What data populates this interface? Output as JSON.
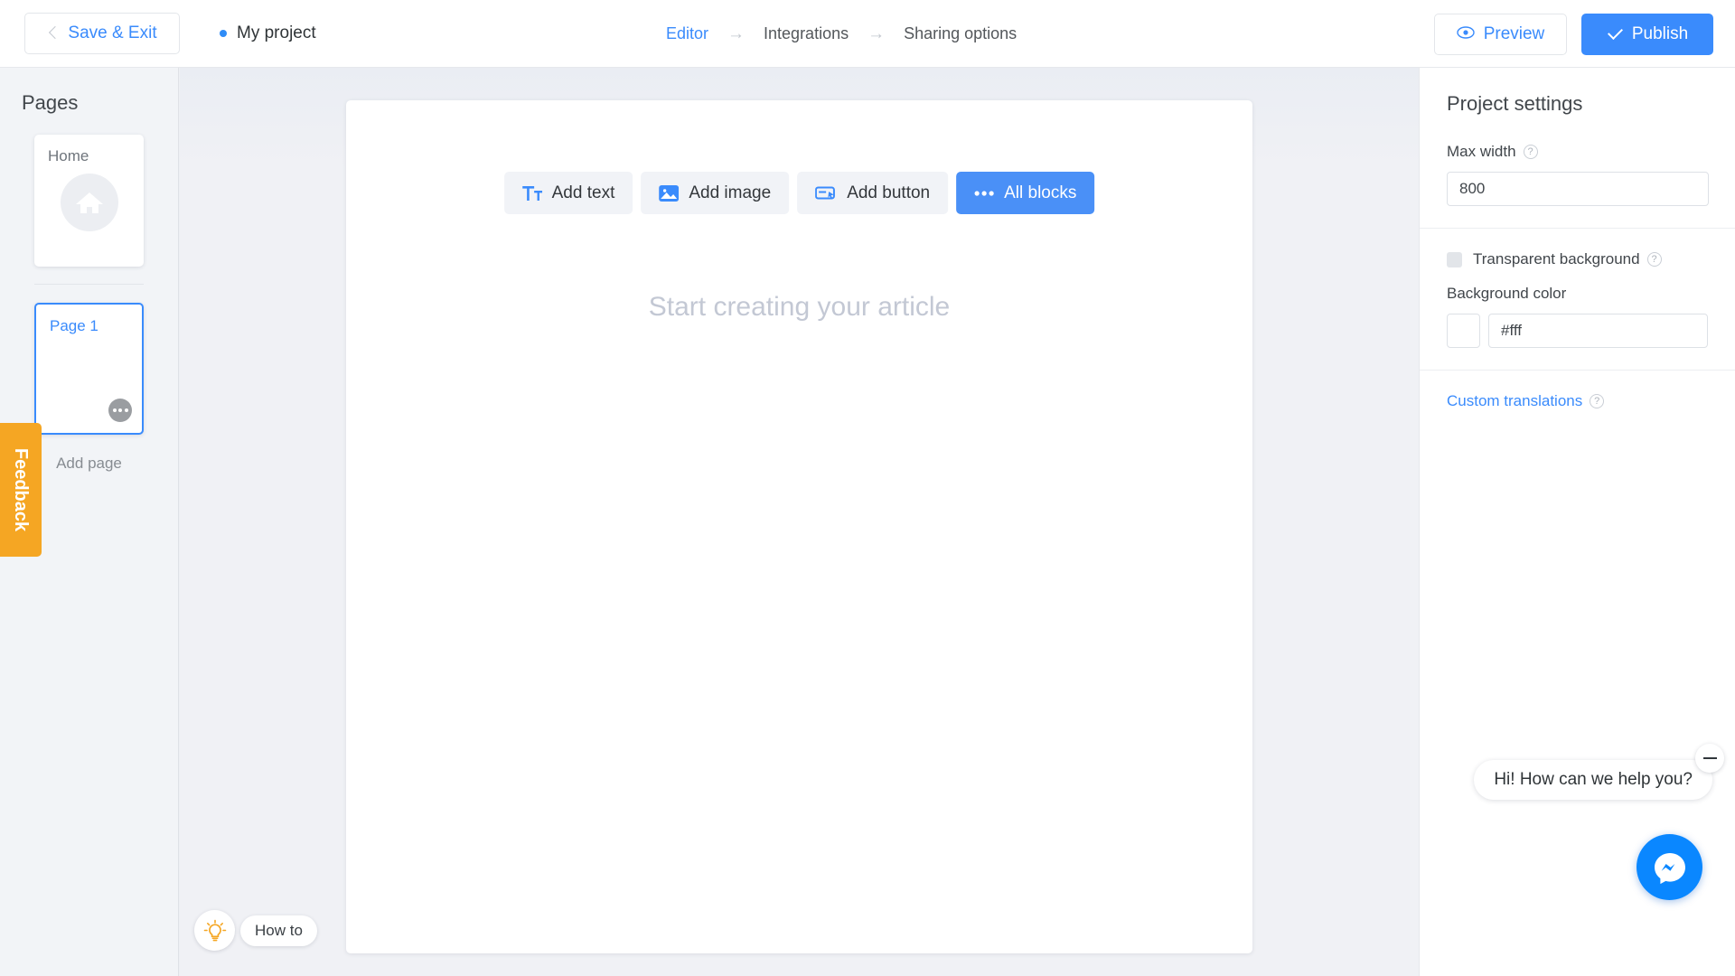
{
  "topbar": {
    "save_exit_label": "Save & Exit",
    "project_name": "My project",
    "breadcrumbs": [
      {
        "label": "Editor",
        "active": true
      },
      {
        "label": "Integrations",
        "active": false
      },
      {
        "label": "Sharing options",
        "active": false
      }
    ],
    "arrow_glyph": "→",
    "preview_label": "Preview",
    "publish_label": "Publish",
    "accent_color": "#3a8bfc"
  },
  "sidebar": {
    "title": "Pages",
    "pages": [
      {
        "label": "Home",
        "selected": false
      },
      {
        "label": "Page 1",
        "selected": true
      }
    ],
    "add_page_label": "Add page",
    "feedback_label": "Feedback",
    "feedback_color": "#f5a623"
  },
  "canvas": {
    "toolbar": [
      {
        "label": "Add text",
        "icon": "text-icon",
        "primary": false
      },
      {
        "label": "Add image",
        "icon": "image-icon",
        "primary": false
      },
      {
        "label": "Add button",
        "icon": "button-icon",
        "primary": false
      },
      {
        "label": "All blocks",
        "icon": "ellipsis-icon",
        "primary": true
      }
    ],
    "placeholder": "Start creating your article",
    "howto_label": "How to"
  },
  "settings": {
    "title": "Project settings",
    "max_width_label": "Max width",
    "max_width_value": "800",
    "transparent_bg_label": "Transparent background",
    "transparent_bg_checked": false,
    "background_color_label": "Background color",
    "background_color_value": "#fff",
    "custom_translations_label": "Custom translations",
    "help_glyph": "?"
  },
  "chat": {
    "message": "Hi! How can we help you?",
    "brand_color": "#0a87ff"
  }
}
